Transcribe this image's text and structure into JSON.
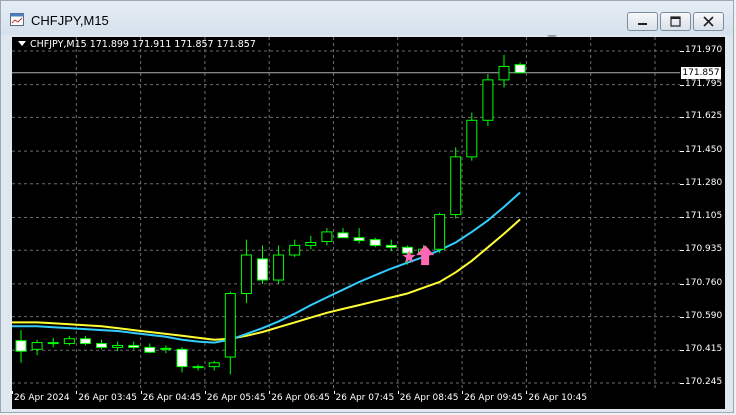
{
  "window": {
    "title": "CHFJPY,M15",
    "buttons": [
      "minimize",
      "restore",
      "close"
    ]
  },
  "chart_header": {
    "text": "CHFJPY,M15  171.899 171.911 171.857 171.857"
  },
  "colors": {
    "background": "#000000",
    "grid": "#6e6e6e",
    "bull_candle": "#00ff00",
    "bull_body": "#000000",
    "bear_body": "#ffffff",
    "ma_fast": "#33ccff",
    "ma_slow": "#ffff33",
    "arrow": "#ff69b4",
    "star": "#ff69b4"
  },
  "price_axis": {
    "labels": [
      "171.970",
      "171.795",
      "171.625",
      "171.450",
      "171.280",
      "171.105",
      "170.935",
      "170.760",
      "170.590",
      "170.415",
      "170.245"
    ],
    "current_price": "171.857"
  },
  "time_axis": {
    "labels": [
      "26 Apr 2024",
      "26 Apr 03:45",
      "26 Apr 04:45",
      "26 Apr 05:45",
      "26 Apr 06:45",
      "26 Apr 07:45",
      "26 Apr 08:45",
      "26 Apr 09:45",
      "26 Apr 10:45"
    ]
  },
  "chart_data": {
    "type": "candlestick",
    "symbol": "CHFJPY",
    "timeframe": "M15",
    "ylim": [
      170.245,
      171.97
    ],
    "candles": [
      {
        "o": 170.465,
        "h": 170.52,
        "l": 170.35,
        "c": 170.41
      },
      {
        "o": 170.42,
        "h": 170.47,
        "l": 170.39,
        "c": 170.455
      },
      {
        "o": 170.455,
        "h": 170.48,
        "l": 170.43,
        "c": 170.45
      },
      {
        "o": 170.45,
        "h": 170.49,
        "l": 170.44,
        "c": 170.475
      },
      {
        "o": 170.475,
        "h": 170.49,
        "l": 170.44,
        "c": 170.45
      },
      {
        "o": 170.45,
        "h": 170.47,
        "l": 170.42,
        "c": 170.43
      },
      {
        "o": 170.43,
        "h": 170.46,
        "l": 170.41,
        "c": 170.44
      },
      {
        "o": 170.44,
        "h": 170.46,
        "l": 170.42,
        "c": 170.43
      },
      {
        "o": 170.43,
        "h": 170.45,
        "l": 170.4,
        "c": 170.405
      },
      {
        "o": 170.425,
        "h": 170.44,
        "l": 170.4,
        "c": 170.42
      },
      {
        "o": 170.42,
        "h": 170.43,
        "l": 170.3,
        "c": 170.33
      },
      {
        "o": 170.325,
        "h": 170.34,
        "l": 170.31,
        "c": 170.33
      },
      {
        "o": 170.33,
        "h": 170.36,
        "l": 170.31,
        "c": 170.35
      },
      {
        "o": 170.38,
        "h": 170.72,
        "l": 170.29,
        "c": 170.71
      },
      {
        "o": 170.71,
        "h": 170.99,
        "l": 170.66,
        "c": 170.91
      },
      {
        "o": 170.89,
        "h": 170.96,
        "l": 170.76,
        "c": 170.78
      },
      {
        "o": 170.78,
        "h": 170.96,
        "l": 170.76,
        "c": 170.91
      },
      {
        "o": 170.91,
        "h": 170.99,
        "l": 170.9,
        "c": 170.96
      },
      {
        "o": 170.96,
        "h": 171.01,
        "l": 170.94,
        "c": 170.975
      },
      {
        "o": 170.98,
        "h": 171.05,
        "l": 170.96,
        "c": 171.03
      },
      {
        "o": 171.025,
        "h": 171.05,
        "l": 171.0,
        "c": 171.0
      },
      {
        "o": 171.0,
        "h": 171.05,
        "l": 170.97,
        "c": 170.985
      },
      {
        "o": 170.99,
        "h": 171.0,
        "l": 170.95,
        "c": 170.96
      },
      {
        "o": 170.96,
        "h": 170.99,
        "l": 170.93,
        "c": 170.95
      },
      {
        "o": 170.95,
        "h": 170.96,
        "l": 170.86,
        "c": 170.92
      },
      {
        "o": 170.92,
        "h": 170.96,
        "l": 170.87,
        "c": 170.94
      },
      {
        "o": 170.94,
        "h": 171.13,
        "l": 170.92,
        "c": 171.12
      },
      {
        "o": 171.12,
        "h": 171.47,
        "l": 171.1,
        "c": 171.42
      },
      {
        "o": 171.42,
        "h": 171.65,
        "l": 171.4,
        "c": 171.61
      },
      {
        "o": 171.61,
        "h": 171.85,
        "l": 171.58,
        "c": 171.82
      },
      {
        "o": 171.82,
        "h": 171.95,
        "l": 171.78,
        "c": 171.89
      },
      {
        "o": 171.899,
        "h": 171.911,
        "l": 171.857,
        "c": 171.857
      }
    ],
    "ma_fast": [
      170.54,
      170.54,
      170.535,
      170.53,
      170.525,
      170.52,
      170.515,
      170.505,
      170.495,
      170.485,
      170.47,
      170.46,
      170.455,
      170.47,
      170.5,
      170.53,
      170.565,
      170.605,
      170.65,
      170.69,
      170.73,
      170.77,
      170.805,
      170.84,
      170.87,
      170.9,
      170.935,
      170.975,
      171.03,
      171.09,
      171.16,
      171.235
    ],
    "ma_slow": [
      170.56,
      170.56,
      170.555,
      170.55,
      170.545,
      170.54,
      170.53,
      170.52,
      170.51,
      170.5,
      170.49,
      170.48,
      170.47,
      170.475,
      170.49,
      170.51,
      170.535,
      170.56,
      170.585,
      170.61,
      170.63,
      170.65,
      170.67,
      170.69,
      170.71,
      170.74,
      170.77,
      170.82,
      170.88,
      170.95,
      171.02,
      171.095
    ],
    "signal": {
      "index": 26,
      "type": "buy"
    }
  }
}
